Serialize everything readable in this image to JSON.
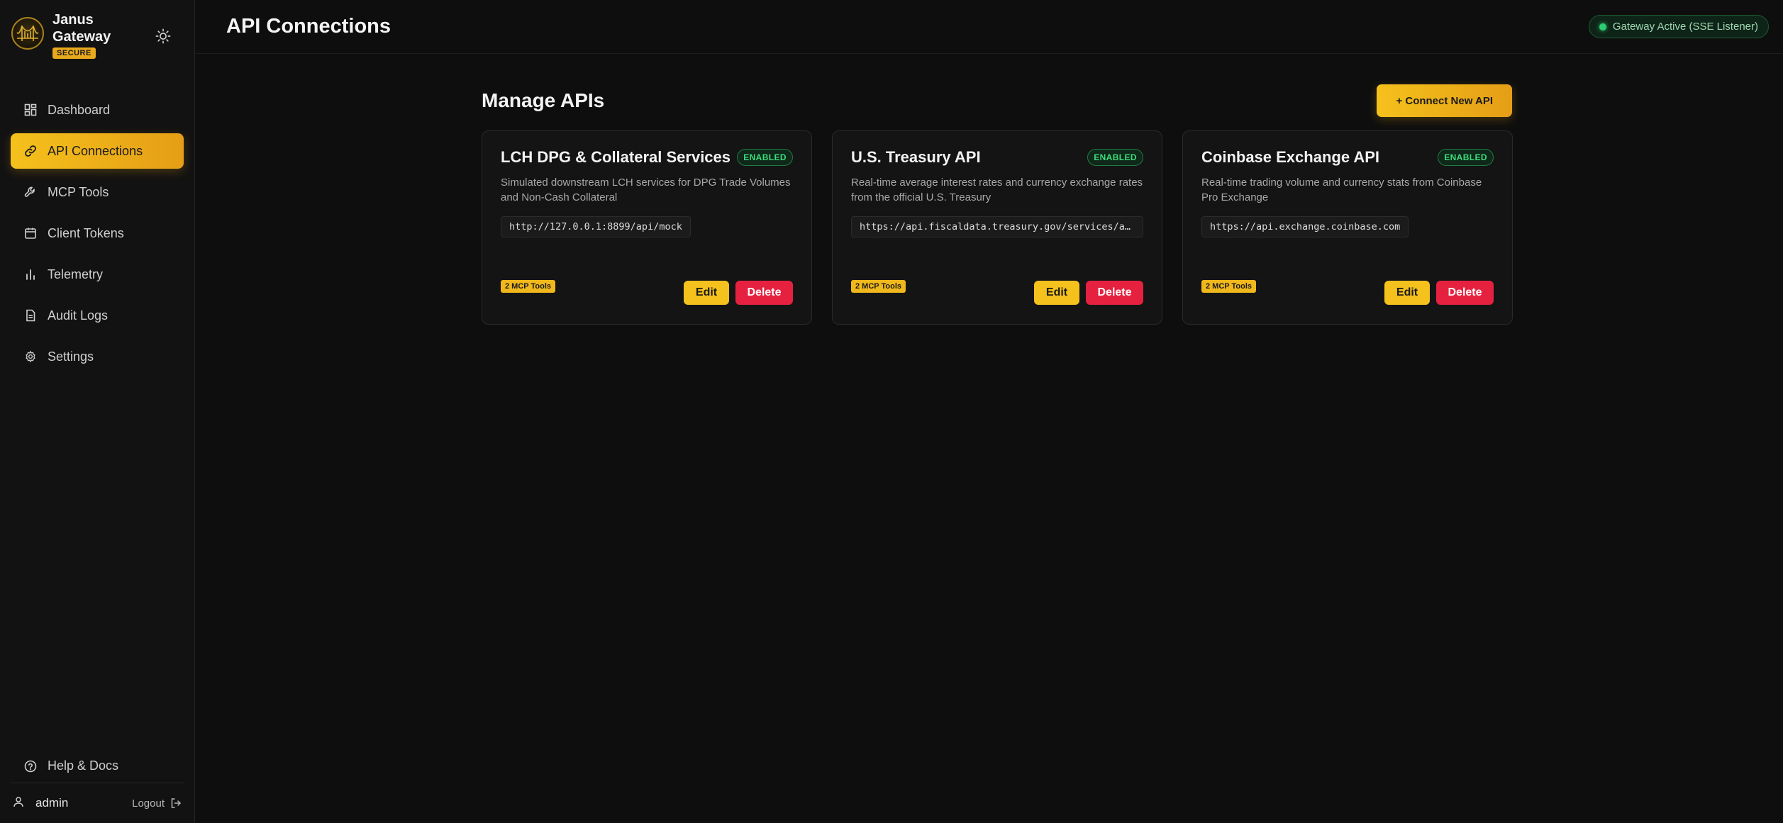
{
  "brand": {
    "name": "Janus Gateway",
    "badge": "SECURE",
    "logo_icon": "gateway-bridge-logo",
    "accent": "#f5c11c"
  },
  "sidebar": {
    "items": [
      {
        "label": "Dashboard",
        "icon": "dashboard-icon",
        "active": false
      },
      {
        "label": "API Connections",
        "icon": "link-icon",
        "active": true
      },
      {
        "label": "MCP Tools",
        "icon": "wrench-icon",
        "active": false
      },
      {
        "label": "Client Tokens",
        "icon": "token-icon",
        "active": false
      },
      {
        "label": "Telemetry",
        "icon": "bar-chart-icon",
        "active": false
      },
      {
        "label": "Audit Logs",
        "icon": "document-icon",
        "active": false
      },
      {
        "label": "Settings",
        "icon": "gear-icon",
        "active": false
      }
    ],
    "help_label": "Help & Docs",
    "user": "admin",
    "logout_label": "Logout"
  },
  "header": {
    "title": "API Connections",
    "status": "Gateway Active (SSE Listener)",
    "status_color": "#2ecc71"
  },
  "main": {
    "section_title": "Manage APIs",
    "connect_button": "+ Connect New API",
    "cards": [
      {
        "title": "LCH DPG & Collateral Services",
        "status": "ENABLED",
        "description": "Simulated downstream LCH services for DPG Trade Volumes and Non-Cash Collateral",
        "url": "http://127.0.0.1:8899/api/mock",
        "tools": "2 MCP Tools",
        "edit": "Edit",
        "delete": "Delete"
      },
      {
        "title": "U.S. Treasury API",
        "status": "ENABLED",
        "description": "Real-time average interest rates and currency exchange rates from the official U.S. Treasury",
        "url": "https://api.fiscaldata.treasury.gov/services/api/fiscal_service",
        "tools": "2 MCP Tools",
        "edit": "Edit",
        "delete": "Delete"
      },
      {
        "title": "Coinbase Exchange API",
        "status": "ENABLED",
        "description": "Real-time trading volume and currency stats from Coinbase Pro Exchange",
        "url": "https://api.exchange.coinbase.com",
        "tools": "2 MCP Tools",
        "edit": "Edit",
        "delete": "Delete"
      }
    ]
  }
}
